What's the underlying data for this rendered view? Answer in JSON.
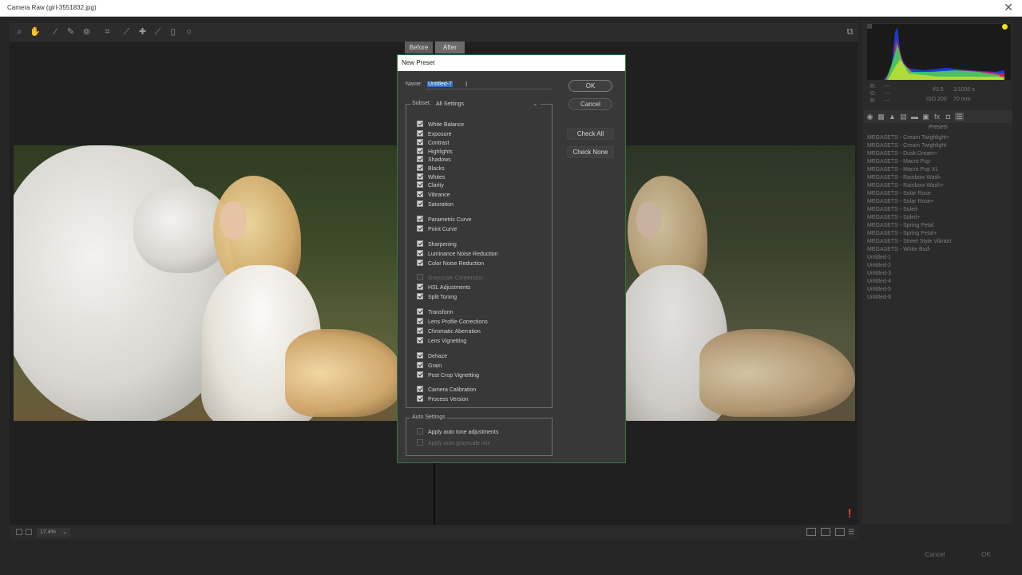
{
  "window": {
    "title": "Camera Raw (girl-3551832.jpg)",
    "close_glyph": "✕"
  },
  "compare_tabs": {
    "before": "Before",
    "after": "After"
  },
  "histogram": {
    "rgb_r": "R:",
    "rgb_g": "G:",
    "rgb_b": "B:",
    "dash_r": "---",
    "dash_g": "---",
    "dash_b": "---",
    "aperture": "f/3.5",
    "shutter": "1/1000 s",
    "iso": "ISO 200",
    "focal": "70 mm"
  },
  "panel": {
    "presets_header": "Presets"
  },
  "presets": [
    "MEGASETS - Cream Twighlight+",
    "MEGASETS - Cream Twighlight-",
    "MEGASETS - Dusk Dream+",
    "MEGASETS - Macro Pop",
    "MEGASETS - Macro Pop XL",
    "MEGASETS - Rainbow Wash",
    "MEGASETS - Rainbow Wash+",
    "MEGASETS - Solar Rose",
    "MEGASETS - Solar Rose+",
    "MEGASETS - Soleil-",
    "MEGASETS - Soleil+",
    "MEGASETS - Spring Petal",
    "MEGASETS - Spring Petal+",
    "MEGASETS - Street Style Vibrant",
    "MEGASETS - White Bud-",
    "Untitled-1",
    "Untitled-2",
    "Untitled-3",
    "Untitled-4",
    "Untitled-5",
    "Untitled-6"
  ],
  "zoom": {
    "value": "17.4%"
  },
  "footer": {
    "cancel": "Cancel",
    "ok": "OK"
  },
  "dialog": {
    "title": "New Preset",
    "name_label": "Name:",
    "name_value": "Untitled-7",
    "ok": "OK",
    "cancel": "Cancel",
    "check_all": "Check All",
    "check_none": "Check None",
    "subset_label": "Subset:",
    "subset_value": "All Settings",
    "auto_label": "Auto Settings",
    "settings": [
      {
        "label": "White Balance",
        "checked": true,
        "enabled": true
      },
      {
        "label": "Exposure",
        "checked": true,
        "enabled": true
      },
      {
        "label": "Contrast",
        "checked": true,
        "enabled": true
      },
      {
        "label": "Highlights",
        "checked": true,
        "enabled": true
      },
      {
        "label": "Shadows",
        "checked": true,
        "enabled": true
      },
      {
        "label": "Blacks",
        "checked": true,
        "enabled": true
      },
      {
        "label": "Whites",
        "checked": true,
        "enabled": true
      },
      {
        "label": "Clarity",
        "checked": true,
        "enabled": true
      },
      {
        "label": "Vibrance",
        "checked": true,
        "enabled": true
      },
      {
        "label": "Saturation",
        "checked": true,
        "enabled": true
      },
      {
        "label": "Parametric Curve",
        "checked": true,
        "enabled": true
      },
      {
        "label": "Point Curve",
        "checked": true,
        "enabled": true
      },
      {
        "label": "Sharpening",
        "checked": true,
        "enabled": true
      },
      {
        "label": "Luminance Noise Reduction",
        "checked": true,
        "enabled": true
      },
      {
        "label": "Color Noise Reduction",
        "checked": true,
        "enabled": true
      },
      {
        "label": "Grayscale Conversion",
        "checked": false,
        "enabled": false
      },
      {
        "label": "HSL Adjustments",
        "checked": true,
        "enabled": true
      },
      {
        "label": "Split Toning",
        "checked": true,
        "enabled": true
      },
      {
        "label": "Transform",
        "checked": true,
        "enabled": true
      },
      {
        "label": "Lens Profile Corrections",
        "checked": true,
        "enabled": true
      },
      {
        "label": "Chromatic Aberration",
        "checked": true,
        "enabled": true
      },
      {
        "label": "Lens Vignetting",
        "checked": true,
        "enabled": true
      },
      {
        "label": "Dehaze",
        "checked": true,
        "enabled": true
      },
      {
        "label": "Grain",
        "checked": true,
        "enabled": true
      },
      {
        "label": "Post Crop Vignetting",
        "checked": true,
        "enabled": true
      },
      {
        "label": "Camera Calibration",
        "checked": true,
        "enabled": true
      },
      {
        "label": "Process Version",
        "checked": true,
        "enabled": true
      }
    ],
    "auto_settings": [
      {
        "label": "Apply auto tone adjustments",
        "checked": false,
        "enabled": true
      },
      {
        "label": "Apply auto grayscale mix",
        "checked": false,
        "enabled": false
      }
    ]
  },
  "icons": {
    "toolbar": [
      "zoom-icon",
      "hand-icon",
      "white-balance-icon",
      "color-sampler-icon",
      "targeted-adjust-icon",
      "crop-icon",
      "straighten-icon",
      "spot-removal-icon",
      "brush-icon",
      "graduated-filter-icon",
      "radial-filter-icon"
    ],
    "panel_tabs": [
      "basic-icon",
      "tone-curve-icon",
      "detail-icon",
      "hsl-icon",
      "split-toning-icon",
      "lens-icon",
      "effects-icon",
      "calibration-icon",
      "presets-icon",
      "snapshots-icon"
    ]
  },
  "colors": {
    "accent": "#2f6fc9",
    "dialog_border": "#2f7a3a"
  }
}
